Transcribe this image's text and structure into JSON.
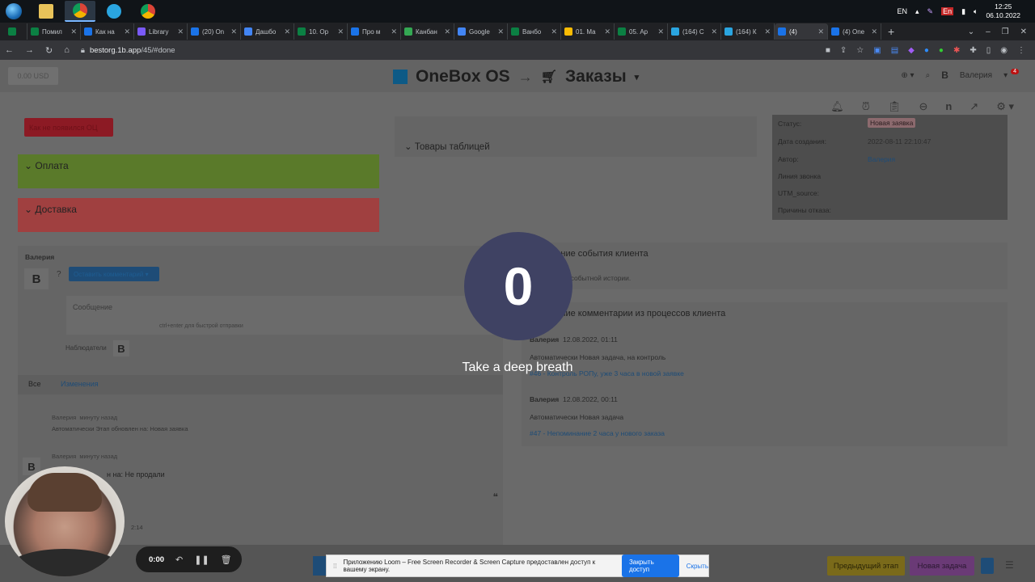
{
  "taskbar": {
    "lang": "EN",
    "lang2": "En",
    "time": "12:25",
    "date": "06.10.2022"
  },
  "tabs": [
    {
      "label": "Помил",
      "color": "#0b8043"
    },
    {
      "label": "Как на",
      "color": "#1a73e8"
    },
    {
      "label": "Library",
      "color": "#7a5af8"
    },
    {
      "label": "(20) On",
      "color": "#1a73e8"
    },
    {
      "label": "Дашбо",
      "color": "#4285f4"
    },
    {
      "label": "10. Ор",
      "color": "#0b8043"
    },
    {
      "label": "Про м",
      "color": "#1a73e8"
    },
    {
      "label": "Канбан",
      "color": "#34a853"
    },
    {
      "label": "Google",
      "color": "#4285f4"
    },
    {
      "label": "Ванбо",
      "color": "#0b8043"
    },
    {
      "label": "01. Ма",
      "color": "#fbbc04"
    },
    {
      "label": "05. Ар",
      "color": "#0b8043"
    },
    {
      "label": "(164) С",
      "color": "#2aa5e0"
    },
    {
      "label": "(164) К",
      "color": "#2aa5e0"
    },
    {
      "label": "(4) ",
      "color": "#1a73e8"
    },
    {
      "label": "(4) One",
      "color": "#1a73e8"
    }
  ],
  "address": {
    "host": "bestorg.1b.app",
    "path": "/45/#done"
  },
  "header": {
    "balance": "0.00 USD",
    "brand": "OneBox OS",
    "section": "Заказы",
    "user_initial": "В",
    "user_name": "Валерия",
    "notif_count": "4"
  },
  "left": {
    "red_chip": "Как не появился ОЦ",
    "payment": "Оплата",
    "delivery": "Доставка",
    "comment_author": "Валерия",
    "comment_avatar": "В",
    "comment_button": "Оставить комментарий",
    "message_placeholder": "Сообщение",
    "message_hint": "ctrl+enter для быстрой отправки",
    "observers_label": "Наблюдатели",
    "observers_initial": "В",
    "feed_tab_all": "Все",
    "feed_tab_changes": "Изменения",
    "feed": [
      {
        "author": "Валерия",
        "time": "минуту назад",
        "text": "Автоматически Этап обновлен на: Новая заявка"
      },
      {
        "author": "Валерия",
        "time": "минуту назад",
        "text": "н на: Не продали"
      }
    ],
    "feed_avatar": "В",
    "feed_partial_time": "2:14"
  },
  "middle": {
    "goods_table": "Товары таблицей"
  },
  "info": {
    "rows": [
      {
        "label": "Статус:",
        "value": "Новая заявка"
      },
      {
        "label": "Дата создания:",
        "value": "2022-08-11 22:10:47"
      },
      {
        "label": "Автор:",
        "value": "Валерия"
      },
      {
        "label": "Линия звонка",
        "value": ""
      },
      {
        "label": "UTM_source:",
        "value": ""
      },
      {
        "label": "Причины отказа:",
        "value": ""
      }
    ]
  },
  "events": {
    "title": "дние события клиента",
    "empty": "ет событной истории.",
    "comments_title": "дние комментарии из процессов клиента",
    "items": [
      {
        "author": "Валерия",
        "time": "12.08.2022, 01:11",
        "text": "Автоматически Новая задача, на контроль",
        "link": "#46 - Контроль РОПу, уже 3 часа в новой заявке"
      },
      {
        "author": "Валерия",
        "time": "12.08.2022, 00:11",
        "text": "Автоматически Новая задача",
        "link": "#47 - Непоминание 2 часа у нового заказа"
      }
    ]
  },
  "overlay": {
    "countdown": "0",
    "message": "Take a deep breath"
  },
  "bottom": {
    "prev_stage": "Предыдущий этап",
    "new_task": "Новая задача"
  },
  "loom": {
    "banner_text": "Приложению Loom – Free Screen Recorder & Screen Capture предоставлен доступ к вашему экрану.",
    "stop_button": "Закрыть доступ",
    "hide_link": "Скрыть",
    "rec_time": "0:00"
  }
}
